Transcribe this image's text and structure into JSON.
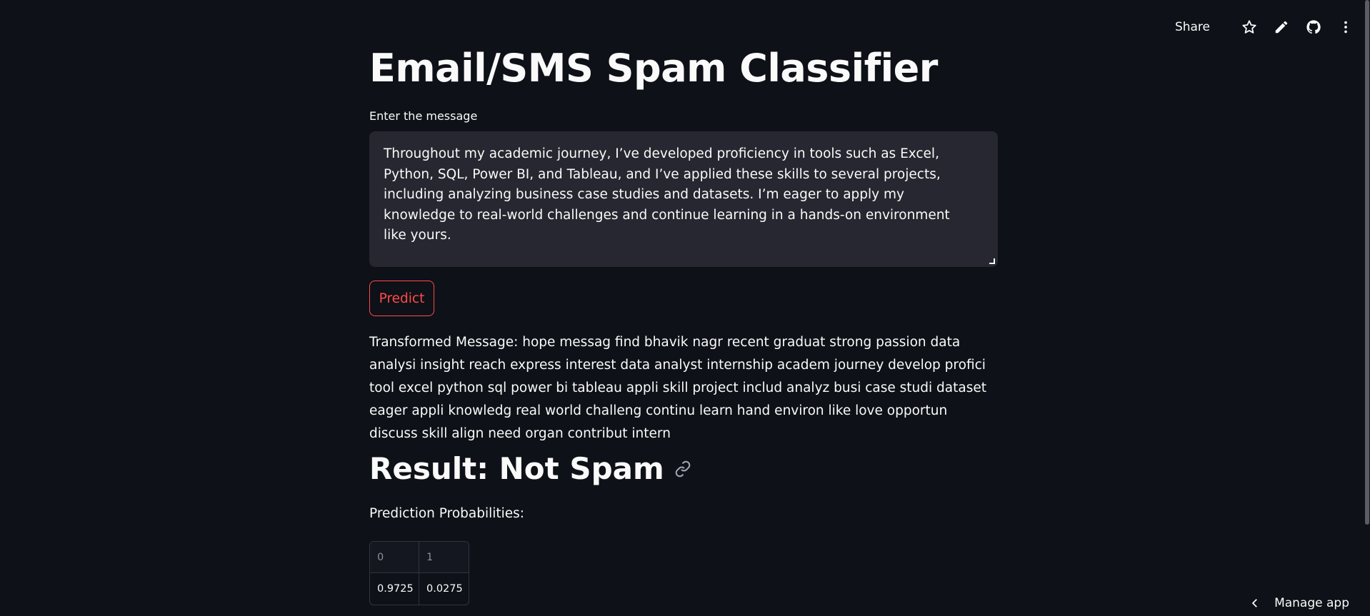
{
  "toolbar": {
    "share_label": "Share",
    "icons": [
      "star-icon",
      "pencil-icon",
      "github-icon",
      "more-vertical-icon"
    ]
  },
  "main": {
    "title": "Email/SMS Spam Classifier",
    "input_label": "Enter the message",
    "input_value": "Hi, my name is Bhavik.\n\nThroughout my academic journey, I’ve developed proficiency in tools such as Excel, Python, SQL, Power BI, and Tableau, and I’ve applied these skills to several projects, including analyzing business case studies and datasets. I’m eager to apply my knowledge to real-world challenges and continue learning in a hands-on environment like yours.\n\n I would love the opportunity to discuss how my skills align with the needs of your organization and",
    "predict_label": "Predict",
    "transformed_message": "Transformed Message: hope messag find bhavik nagr recent graduat strong passion data analysi insight reach express interest data analyst internship academ journey develop profici tool excel python sql power bi tableau appli skill project includ analyz busi case studi dataset eager appli knowledg real world challeng continu learn hand environ like love opportun discuss skill align need organ contribut intern",
    "result": "Result: Not Spam",
    "prob_label": "Prediction Probabilities:",
    "prob_table": {
      "headers": [
        "0",
        "1"
      ],
      "values": [
        "0.9725",
        "0.0275"
      ]
    }
  },
  "footer": {
    "manage_label": "Manage app"
  },
  "colors": {
    "background": "#0e1117",
    "accent": "#ff4b4b",
    "textarea_bg": "#262730"
  }
}
